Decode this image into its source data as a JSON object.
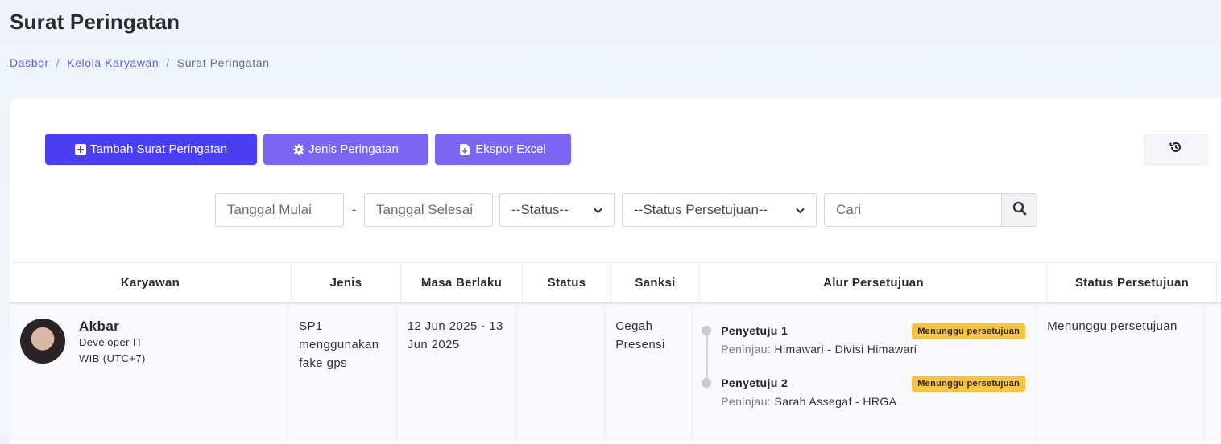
{
  "page": {
    "title": "Surat Peringatan",
    "breadcrumb": [
      {
        "label": "Dasbor"
      },
      {
        "label": "Kelola Karyawan"
      },
      {
        "label": "Surat Peringatan"
      }
    ],
    "breadcrumb_separator": "/"
  },
  "toolbar": {
    "add_label": "Tambah Surat Peringatan",
    "add_icon": "plus-square-icon",
    "types_label": "Jenis Peringatan",
    "types_icon": "gear-icon",
    "export_label": "Ekspor Excel",
    "export_icon": "file-download-icon",
    "history_icon": "history-icon"
  },
  "filters": {
    "start_date_placeholder": "Tanggal Mulai",
    "date_separator": "-",
    "end_date_placeholder": "Tanggal Selesai",
    "status_selected": "--Status--",
    "approval_status_selected": "--Status Persetujuan--",
    "search_placeholder": "Cari",
    "search_icon": "search-icon"
  },
  "table": {
    "columns": [
      "Karyawan",
      "Jenis",
      "Masa Berlaku",
      "Status",
      "Sanksi",
      "Alur Persetujuan",
      "Status Persetujuan"
    ],
    "rows": [
      {
        "employee": {
          "name": "Akbar",
          "position": "Developer IT",
          "timezone": "WIB (UTC+7)"
        },
        "type": "SP1 menggunakan fake gps",
        "validity": "12 Jun 2025 - 13 Jun 2025",
        "status": "",
        "sanction": "Cegah Presensi",
        "approval_flow": [
          {
            "title": "Penyetuju 1",
            "badge": "Menunggu persetujuan",
            "reviewer_label": "Peninjau:",
            "reviewer": "Himawari - Divisi Himawari"
          },
          {
            "title": "Penyetuju 2",
            "badge": "Menunggu persetujuan",
            "reviewer_label": "Peninjau:",
            "reviewer": "Sarah Assegaf - HRGA"
          }
        ],
        "approval_status": "Menunggu persetujuan"
      }
    ]
  },
  "colors": {
    "primary": "#4b3ef0",
    "secondary": "#7b66f3",
    "badge_warning": "#f6c445"
  }
}
